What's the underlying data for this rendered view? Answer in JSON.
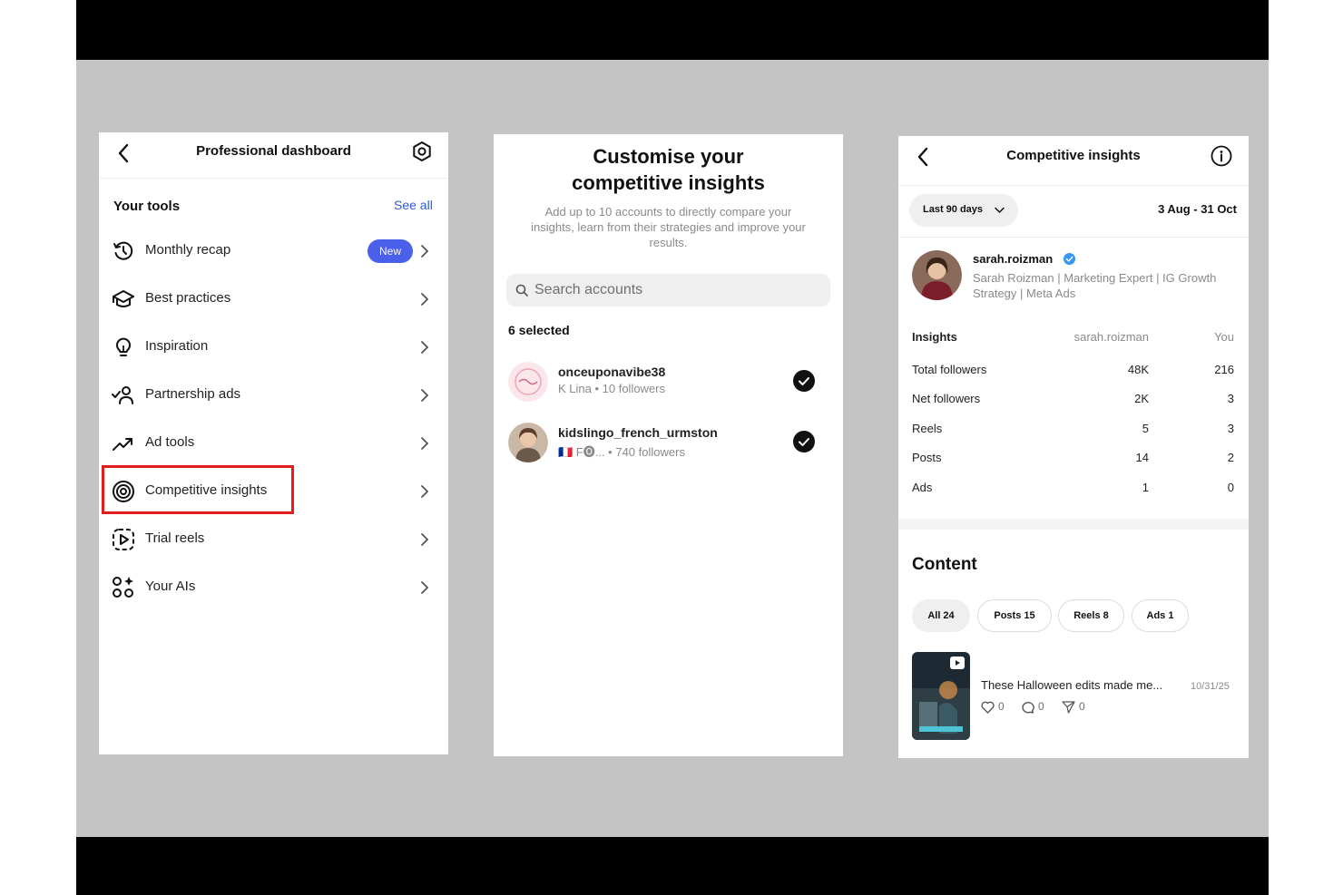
{
  "colors": {
    "accent": "#4a5fea",
    "highlight": "#e21b1b",
    "link": "#2f5bd6",
    "verified": "#3897f0"
  },
  "dashboard": {
    "title": "Professional dashboard",
    "section_title": "Your tools",
    "see_all": "See all",
    "items": [
      {
        "label": "Monthly recap",
        "icon": "history-icon",
        "badge": "New"
      },
      {
        "label": "Best practices",
        "icon": "graduation-cap-icon"
      },
      {
        "label": "Inspiration",
        "icon": "lightbulb-icon"
      },
      {
        "label": "Partnership ads",
        "icon": "partnership-icon"
      },
      {
        "label": "Ad tools",
        "icon": "trend-up-icon"
      },
      {
        "label": "Competitive insights",
        "icon": "target-icon",
        "highlighted": true
      },
      {
        "label": "Trial reels",
        "icon": "reel-play-icon"
      },
      {
        "label": "Your AIs",
        "icon": "ai-grid-icon"
      }
    ]
  },
  "customise": {
    "title_line1": "Customise your",
    "title_line2": "competitive insights",
    "description": "Add up to 10 accounts to directly compare your insights, learn from their strategies and improve your results.",
    "search_placeholder": "Search accounts",
    "selected_count": "6 selected",
    "accounts": [
      {
        "username": "onceuponavibe38",
        "subtitle": "K Lina • 10 followers",
        "checked": true
      },
      {
        "username": "kidslingo_french_urmston",
        "subtitle": "🇫🇷 F🅞... • 740 followers",
        "checked": true
      }
    ]
  },
  "insights": {
    "title": "Competitive insights",
    "range_label": "Last 90 days",
    "date_range": "3 Aug - 31 Oct",
    "profile": {
      "username": "sarah.roizman",
      "bio": "Sarah Roizman | Marketing Expert | IG Growth Strategy | Meta Ads"
    },
    "table": {
      "headers": [
        "Insights",
        "sarah.roizman",
        "You"
      ],
      "rows": [
        [
          "Total followers",
          "48K",
          "216"
        ],
        [
          "Net followers",
          "2K",
          "3"
        ],
        [
          "Reels",
          "5",
          "3"
        ],
        [
          "Posts",
          "14",
          "2"
        ],
        [
          "Ads",
          "1",
          "0"
        ]
      ]
    },
    "content_title": "Content",
    "chips": [
      "All 24",
      "Posts 15",
      "Reels 8",
      "Ads 1"
    ],
    "post": {
      "title": "These Halloween edits made me...",
      "date": "10/31/25",
      "likes": "0",
      "comments": "0",
      "shares": "0"
    }
  }
}
